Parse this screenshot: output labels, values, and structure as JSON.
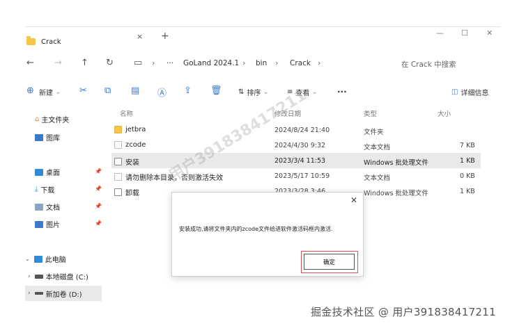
{
  "tab": {
    "title": "Crack",
    "close": "×",
    "new": "+"
  },
  "window_controls": {
    "minimize": "—",
    "maximize": "☐",
    "close": "✕"
  },
  "nav": {
    "back": "←",
    "forward": "→",
    "up": "↑",
    "refresh": "↻",
    "monitor": "▭",
    "more": "···",
    "breadcrumbs": [
      "GoLand 2024.1",
      "bin",
      "Crack"
    ],
    "sep": "›",
    "search_placeholder": "在 Crack 中搜索"
  },
  "command_bar": {
    "new": "新建",
    "sort": "排序",
    "view": "查看",
    "more": "···",
    "details": "详细信息"
  },
  "sidebar": {
    "home": "主文件夹",
    "gallery": "图库",
    "quick": [
      "桌面",
      "下载",
      "文档",
      "图片"
    ],
    "this_pc": "此电脑",
    "drives": [
      "本地磁盘 (C:)",
      "新加卷 (D:)"
    ]
  },
  "table": {
    "headers": [
      "名称",
      "修改日期",
      "类型",
      "大小"
    ],
    "rows": [
      {
        "name": "jetbra",
        "date": "2024/8/24 21:40",
        "type": "文件夹",
        "size": ""
      },
      {
        "name": "zcode",
        "date": "2024/4/30 9:32",
        "type": "文本文档",
        "size": "7 KB"
      },
      {
        "name": "安装",
        "date": "2023/3/4 11:53",
        "type": "Windows 批处理文件",
        "size": "1 KB"
      },
      {
        "name": "请勿删除本目录，否则激活失效",
        "date": "2023/5/17 10:59",
        "type": "文本文档",
        "size": "0 KB"
      },
      {
        "name": "卸载",
        "date": "2023/3/28 3:46",
        "type": "Windows 批处理文件",
        "size": "1 KB"
      }
    ]
  },
  "dialog": {
    "close": "✕",
    "message": "安装成功,请将文件夹内的zcode文件给进软件激活码框内激活.",
    "ok": "确定"
  },
  "watermarks": {
    "diagonal": "用户391838417211",
    "footer": "掘金技术社区 @ 用户391838417211"
  },
  "colors": {
    "accent": "#3a78c9",
    "folder": "#f3c64a",
    "selected_row": "#e9e9e9",
    "dialog_highlight": "#d9534f"
  }
}
